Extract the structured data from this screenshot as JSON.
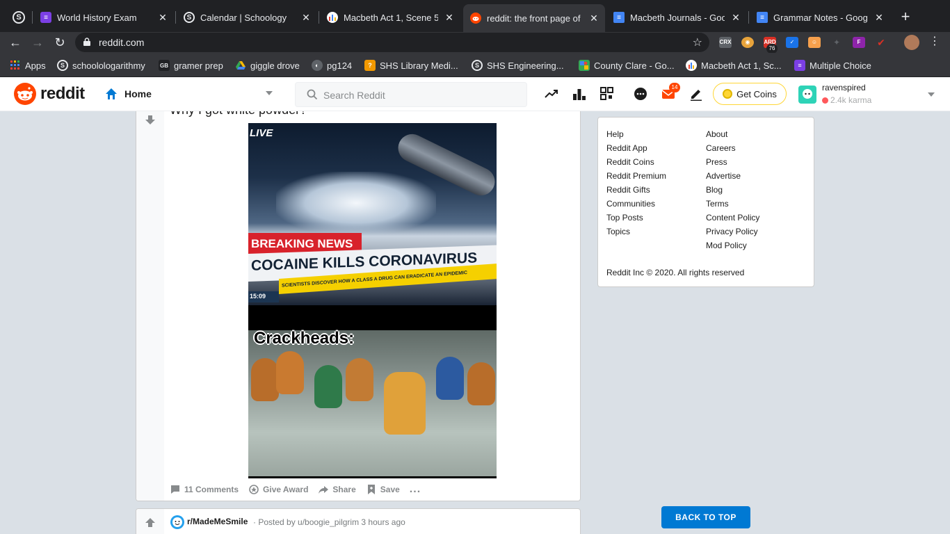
{
  "browser": {
    "tabs": [
      {
        "title": "World History Exam",
        "favicon": "purple-list-icon",
        "color": "#7b3fe4"
      },
      {
        "title": "Calendar | Schoology",
        "favicon": "schoology-icon",
        "color": "#202124"
      },
      {
        "title": "Macbeth Act 1, Scene 5 T",
        "favicon": "chart-icon",
        "color": "#ffffff"
      },
      {
        "title": "reddit: the front page of t",
        "favicon": "reddit-icon",
        "color": "#ff4500"
      },
      {
        "title": "Macbeth Journals - Goog",
        "favicon": "google-docs-icon",
        "color": "#4285f4"
      },
      {
        "title": "Grammar Notes - Google",
        "favicon": "google-docs-icon",
        "color": "#4285f4"
      }
    ],
    "active_tab_index": 3,
    "url": "reddit.com",
    "extension_badge": "76",
    "bookmarks": [
      {
        "label": "Apps"
      },
      {
        "label": "schoolologarithmy"
      },
      {
        "label": "gramer prep"
      },
      {
        "label": "giggle drove"
      },
      {
        "label": "pg124"
      },
      {
        "label": "SHS Library Medi..."
      },
      {
        "label": "SHS Engineering..."
      },
      {
        "label": "County Clare - Go..."
      },
      {
        "label": "Macbeth Act 1, Sc..."
      },
      {
        "label": "Multiple Choice"
      }
    ]
  },
  "reddit": {
    "wordmark": "reddit",
    "feed_selector": "Home",
    "search_placeholder": "Search Reddit",
    "notification_count": "14",
    "get_coins_label": "Get Coins",
    "username": "ravenspired",
    "karma": "2.4k karma"
  },
  "post": {
    "title": "Why I got white powder?",
    "image": {
      "live_label": "LIVE",
      "breaking_label": "BREAKING NEWS",
      "headline": "COCAINE KILLS CORONAVIRUS",
      "ticker": "SCIENTISTS DISCOVER HOW A CLASS A DRUG CAN ERADICATE AN EPIDEMIC",
      "time": "15:09",
      "caption": "Crackheads:"
    },
    "actions": {
      "comments": "11 Comments",
      "award": "Give Award",
      "share": "Share",
      "save": "Save",
      "more": "..."
    }
  },
  "next_post": {
    "subreddit": "r/MadeMeSmile",
    "meta": "· Posted by u/boogie_pilgrim 3 hours ago"
  },
  "sidebar": {
    "left_links": [
      "Help",
      "Reddit App",
      "Reddit Coins",
      "Reddit Premium",
      "Reddit Gifts",
      "Communities",
      "Top Posts",
      "Topics"
    ],
    "right_links": [
      "About",
      "Careers",
      "Press",
      "Advertise",
      "Blog",
      "Terms",
      "Content Policy",
      "Privacy Policy",
      "Mod Policy"
    ],
    "copyright": "Reddit Inc © 2020. All rights reserved",
    "back_to_top": "BACK TO TOP"
  }
}
